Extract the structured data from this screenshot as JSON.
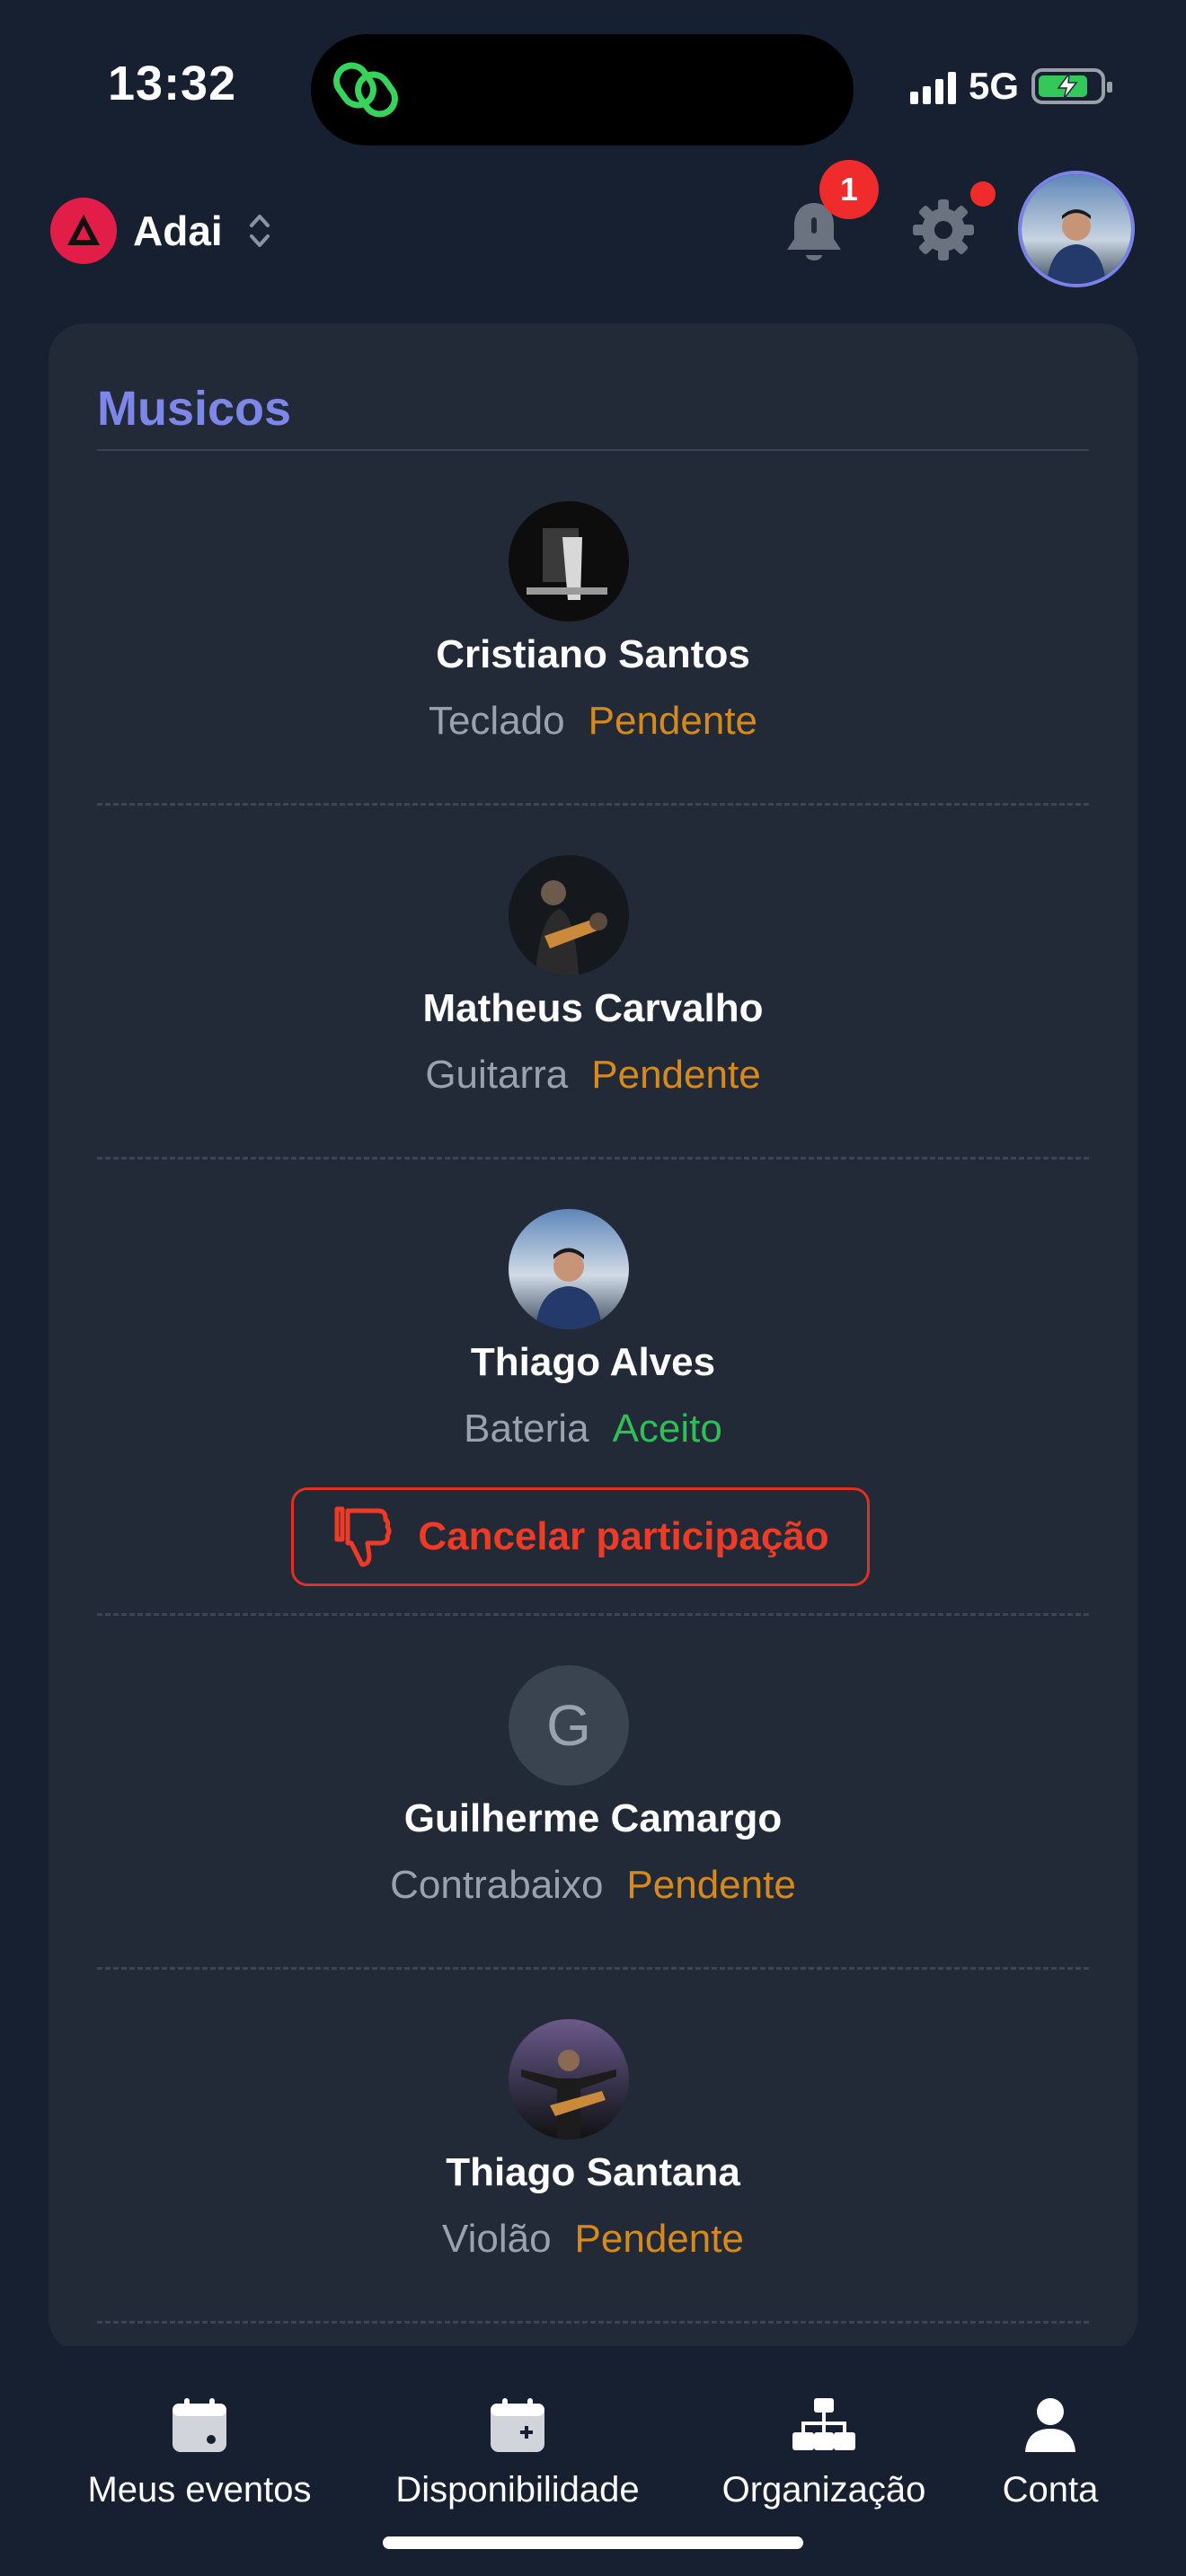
{
  "status_bar": {
    "time": "13:32",
    "network": "5G"
  },
  "header": {
    "org_name": "Adai",
    "notification_count": "1"
  },
  "section": {
    "title": "Musicos"
  },
  "members": [
    {
      "name": "Cristiano Santos",
      "role": "Teclado",
      "status": "Pendente"
    },
    {
      "name": "Matheus Carvalho",
      "role": "Guitarra",
      "status": "Pendente"
    },
    {
      "name": "Thiago Alves",
      "role": "Bateria",
      "status": "Aceito",
      "action": "Cancelar participação"
    },
    {
      "name": "Guilherme Camargo",
      "role": "Contrabaixo",
      "status": "Pendente",
      "initial": "G"
    },
    {
      "name": "Thiago Santana",
      "role": "Violão",
      "status": "Pendente"
    }
  ],
  "bottom_nav": [
    {
      "label": "Meus eventos",
      "icon": "calendar-icon"
    },
    {
      "label": "Disponibilidade",
      "icon": "calendar-add-icon"
    },
    {
      "label": "Organização",
      "icon": "org-chart-icon"
    },
    {
      "label": "Conta",
      "icon": "user-icon"
    }
  ],
  "colors": {
    "background": "#172030",
    "card": "#222a38",
    "accent": "#7c87e8",
    "pending": "#d78a1c",
    "accepted": "#2fbf54",
    "danger": "#ef3b26"
  }
}
